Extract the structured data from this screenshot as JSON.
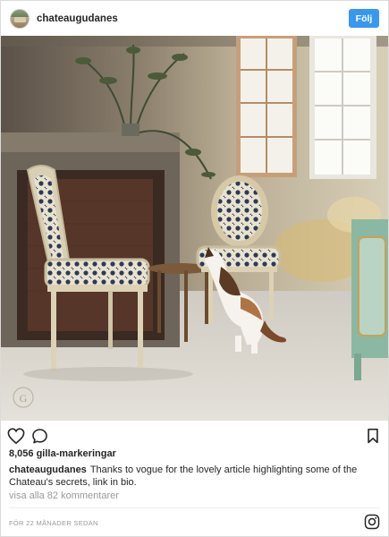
{
  "header": {
    "username": "chateaugudanes",
    "follow_label": "Följ"
  },
  "photo": {
    "watermark_letter": "G"
  },
  "actions": {
    "like_icon": "heart-icon",
    "comment_icon": "comment-icon",
    "save_icon": "bookmark-icon"
  },
  "likes_text": "8,056 gilla-markeringar",
  "caption": {
    "username": "chateaugudanes",
    "text": "Thanks to vogue for the lovely article highlighting some of the Chateau's secrets, link in bio."
  },
  "view_comments": "visa alla 82 kommentarer",
  "timestamp": "FÖR 22 MÅNADER SEDAN",
  "footer": {
    "icon": "instagram-icon"
  },
  "colors": {
    "accent": "#3897f0",
    "text": "#262626",
    "muted": "#999999"
  }
}
